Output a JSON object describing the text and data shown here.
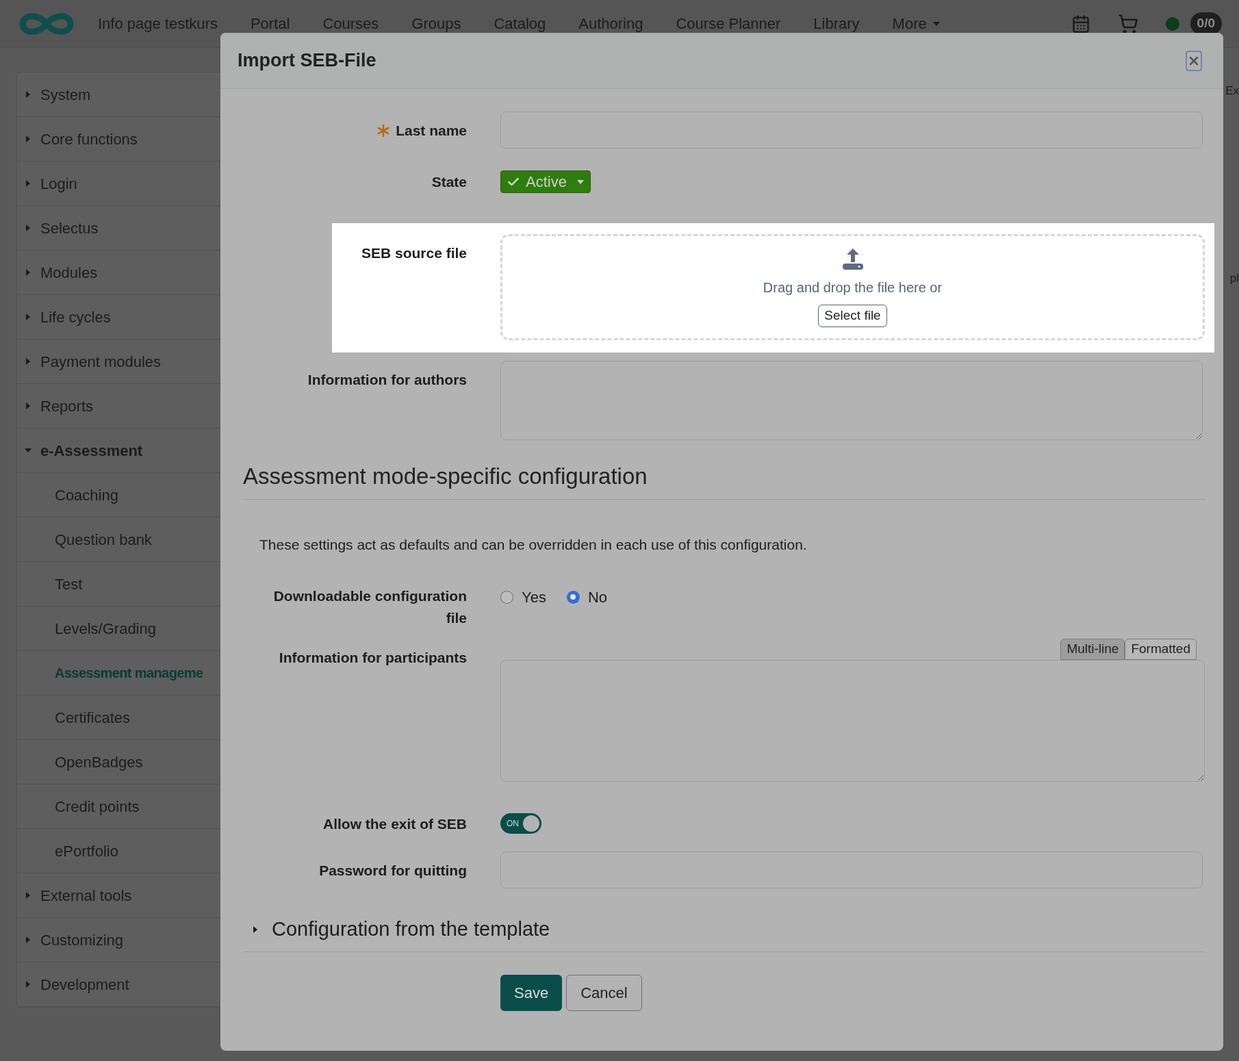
{
  "nav": {
    "items": [
      "Info page testkurs",
      "Portal",
      "Courses",
      "Groups",
      "Catalog",
      "Authoring",
      "Course Planner",
      "Library"
    ],
    "more": "More",
    "counter": "0/0"
  },
  "sidebar": {
    "items": [
      {
        "label": "System",
        "expanded": false
      },
      {
        "label": "Core functions",
        "expanded": false
      },
      {
        "label": "Login",
        "expanded": false
      },
      {
        "label": "Selectus",
        "expanded": false
      },
      {
        "label": "Modules",
        "expanded": false
      },
      {
        "label": "Life cycles",
        "expanded": false
      },
      {
        "label": "Payment modules",
        "expanded": false
      },
      {
        "label": "Reports",
        "expanded": false
      },
      {
        "label": "e-Assessment",
        "expanded": true,
        "children": [
          {
            "label": "Coaching",
            "selected": false
          },
          {
            "label": "Question bank",
            "selected": false
          },
          {
            "label": "Test",
            "selected": false
          },
          {
            "label": "Levels/Grading",
            "selected": false
          },
          {
            "label": "Assessment manageme",
            "selected": true
          },
          {
            "label": "Certificates",
            "selected": false
          },
          {
            "label": "OpenBadges",
            "selected": false
          },
          {
            "label": "Credit points",
            "selected": false
          },
          {
            "label": "ePortfolio",
            "selected": false
          }
        ]
      },
      {
        "label": "External tools",
        "expanded": false
      },
      {
        "label": "Customizing",
        "expanded": false
      },
      {
        "label": "Development",
        "expanded": false
      }
    ]
  },
  "background_fragments": [
    "Ex",
    "pl"
  ],
  "modal": {
    "title": "Import SEB-File",
    "last_name": {
      "label": "Last name",
      "required": true
    },
    "state": {
      "label": "State",
      "value": "Active"
    },
    "seb_file": {
      "label": "SEB source file",
      "drop_text": "Drag and drop the file here or",
      "button": "Select file"
    },
    "authors_info": {
      "label": "Information for authors"
    },
    "section_heading": "Assessment mode-specific configuration",
    "section_note": "These settings act as defaults and can be overridden in each use of this configuration.",
    "downloadable": {
      "label": "Downloadable configuration file",
      "options": [
        {
          "label": "Yes",
          "selected": false
        },
        {
          "label": "No",
          "selected": true
        }
      ]
    },
    "participants_info": {
      "label": "Information for participants",
      "tabs": [
        {
          "label": "Multi-line",
          "selected": true
        },
        {
          "label": "Formatted",
          "selected": false
        }
      ]
    },
    "allow_exit": {
      "label": "Allow the exit of SEB",
      "on": true,
      "toggle_text": "ON"
    },
    "password": {
      "label": "Password for quitting"
    },
    "template_section": {
      "label": "Configuration from the template",
      "expanded": false
    },
    "buttons": {
      "save": "Save",
      "cancel": "Cancel"
    }
  }
}
